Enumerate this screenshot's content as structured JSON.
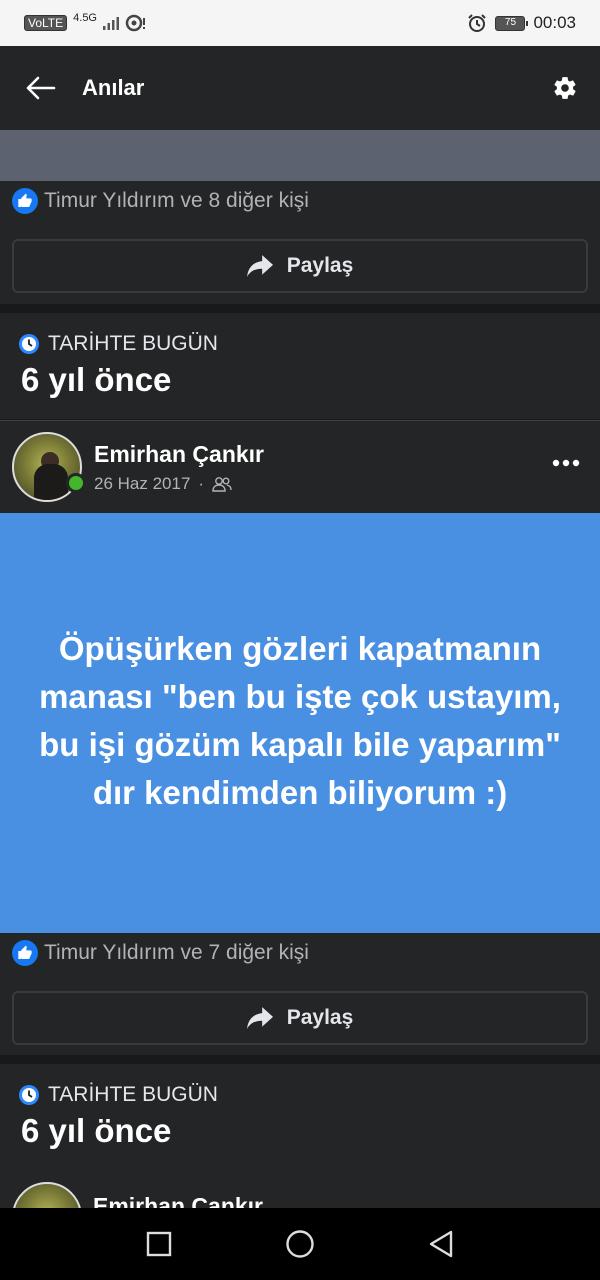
{
  "status_bar": {
    "volte": "VoLTE",
    "network": "4.5G",
    "battery": "75",
    "time": "00:03"
  },
  "app_bar": {
    "title": "Anılar"
  },
  "post1": {
    "reactions_text": "Timur Yıldırım ve 8 diğer kişi",
    "share_label": "Paylaş"
  },
  "section1": {
    "label": "TARİHTE BUGÜN",
    "ago": "6 yıl önce"
  },
  "post2": {
    "author": "Emirhan Çankır",
    "date": "26 Haz 2017",
    "separator": "·",
    "body": "Öpüşürken gözleri kapatmanın manası \"ben bu işte çok ustayım, bu işi gözüm kapalı bile yaparım\" dır kendimden biliyorum :)",
    "body_bg_color": "#4a90e2",
    "reactions_text": "Timur Yıldırım ve 7 diğer kişi",
    "share_label": "Paylaş"
  },
  "section2": {
    "label": "TARİHTE BUGÜN",
    "ago": "6 yıl önce"
  },
  "post3": {
    "author": "Emirhan Çankır"
  },
  "icons": {
    "back": "arrow-left",
    "settings": "gear",
    "like": "thumbs-up",
    "share": "share-arrow",
    "memories": "clock",
    "privacy": "friends",
    "more": "ellipsis"
  }
}
